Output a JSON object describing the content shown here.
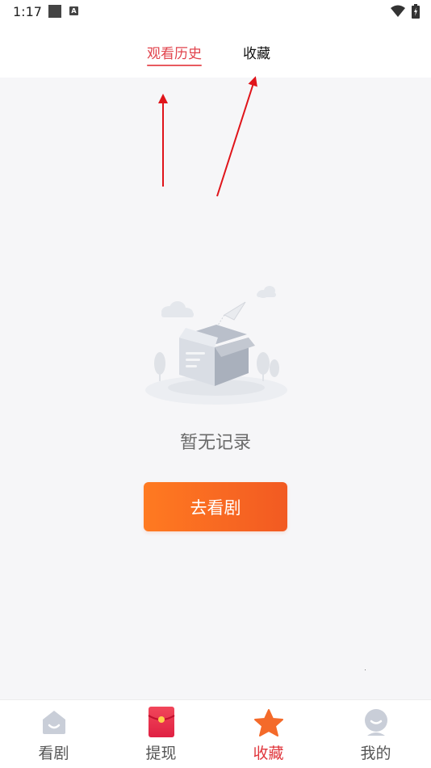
{
  "status_bar": {
    "time": "1:17",
    "status_icon_letter": "A"
  },
  "top_tabs": [
    {
      "label": "观看历史",
      "active": true
    },
    {
      "label": "收藏",
      "active": false
    }
  ],
  "empty_state": {
    "message": "暂无记录",
    "button_label": "去看剧"
  },
  "bottom_nav": [
    {
      "label": "看剧",
      "icon": "theater-icon"
    },
    {
      "label": "提现",
      "icon": "red-envelope-icon"
    },
    {
      "label": "收藏",
      "icon": "star-icon",
      "active": true
    },
    {
      "label": "我的",
      "icon": "profile-icon"
    }
  ],
  "colors": {
    "accent_red": "#e1444d",
    "button_orange_start": "#ff7a21",
    "button_orange_end": "#f25a22",
    "background": "#f6f6f8"
  }
}
